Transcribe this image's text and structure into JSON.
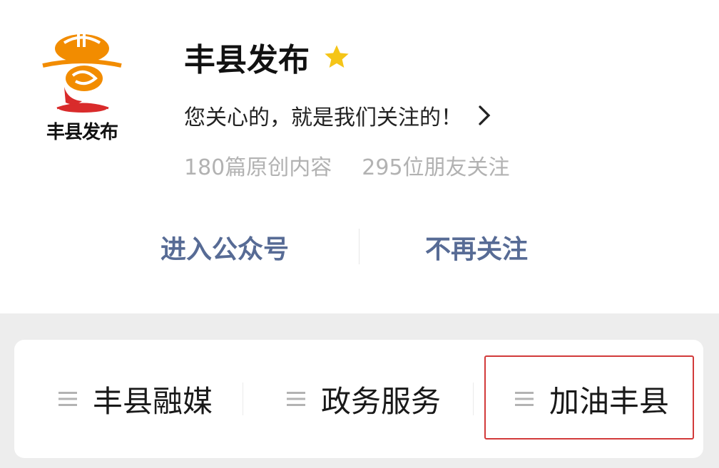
{
  "account": {
    "name": "丰县发布",
    "logo_text": "丰县发布",
    "slogan": "您关心的，就是我们关注的！",
    "stats": {
      "articles": "180篇原创内容",
      "followers": "295位朋友关注"
    }
  },
  "actions": {
    "enter": "进入公众号",
    "unfollow": "不再关注"
  },
  "menu": {
    "items": [
      {
        "label": "丰县融媒"
      },
      {
        "label": "政务服务"
      },
      {
        "label": "加油丰县"
      }
    ]
  },
  "colors": {
    "star": "#f5c518",
    "link_blue": "#576b95",
    "highlight_red": "#d23a3a",
    "logo_orange": "#f28c00",
    "logo_red": "#d92b2b"
  }
}
